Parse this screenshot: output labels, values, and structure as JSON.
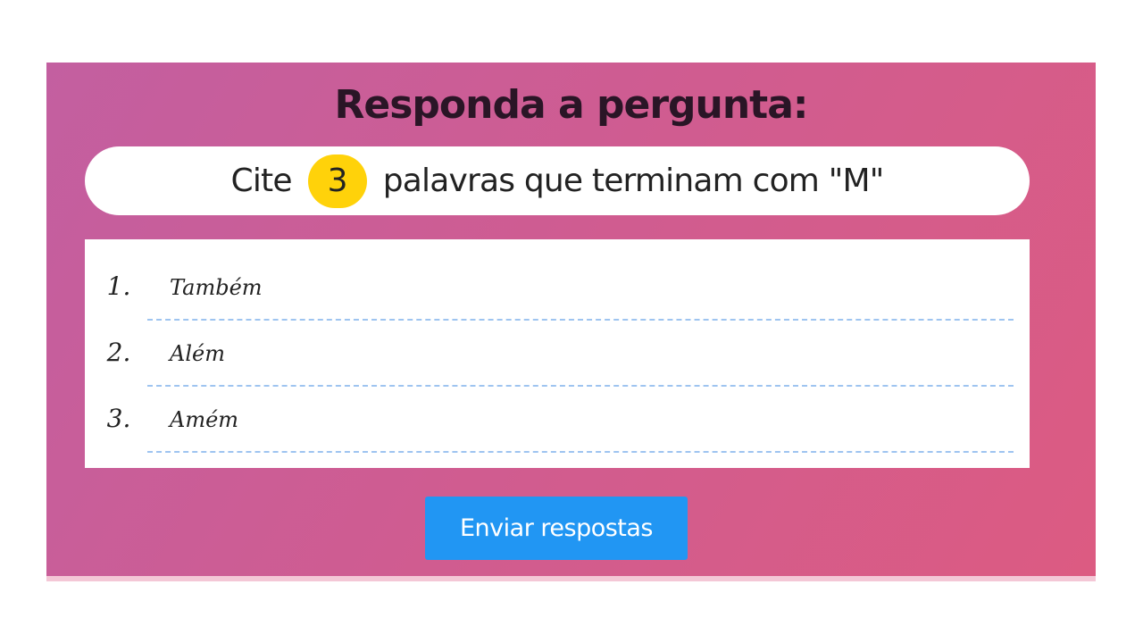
{
  "heading": "Responda a pergunta:",
  "question": {
    "prefix": "Cite",
    "count": "3",
    "suffix": "palavras que terminam com \"M\""
  },
  "answers": [
    {
      "number": "1.",
      "value": "Também"
    },
    {
      "number": "2.",
      "value": "Além"
    },
    {
      "number": "3.",
      "value": "Amém"
    }
  ],
  "submit_label": "Enviar respostas",
  "colors": {
    "background_start": "#c35fa0",
    "background_end": "#dc5b82",
    "badge": "#ffd20a",
    "button": "#2196f3",
    "dashed_line": "#9ec4f0"
  }
}
